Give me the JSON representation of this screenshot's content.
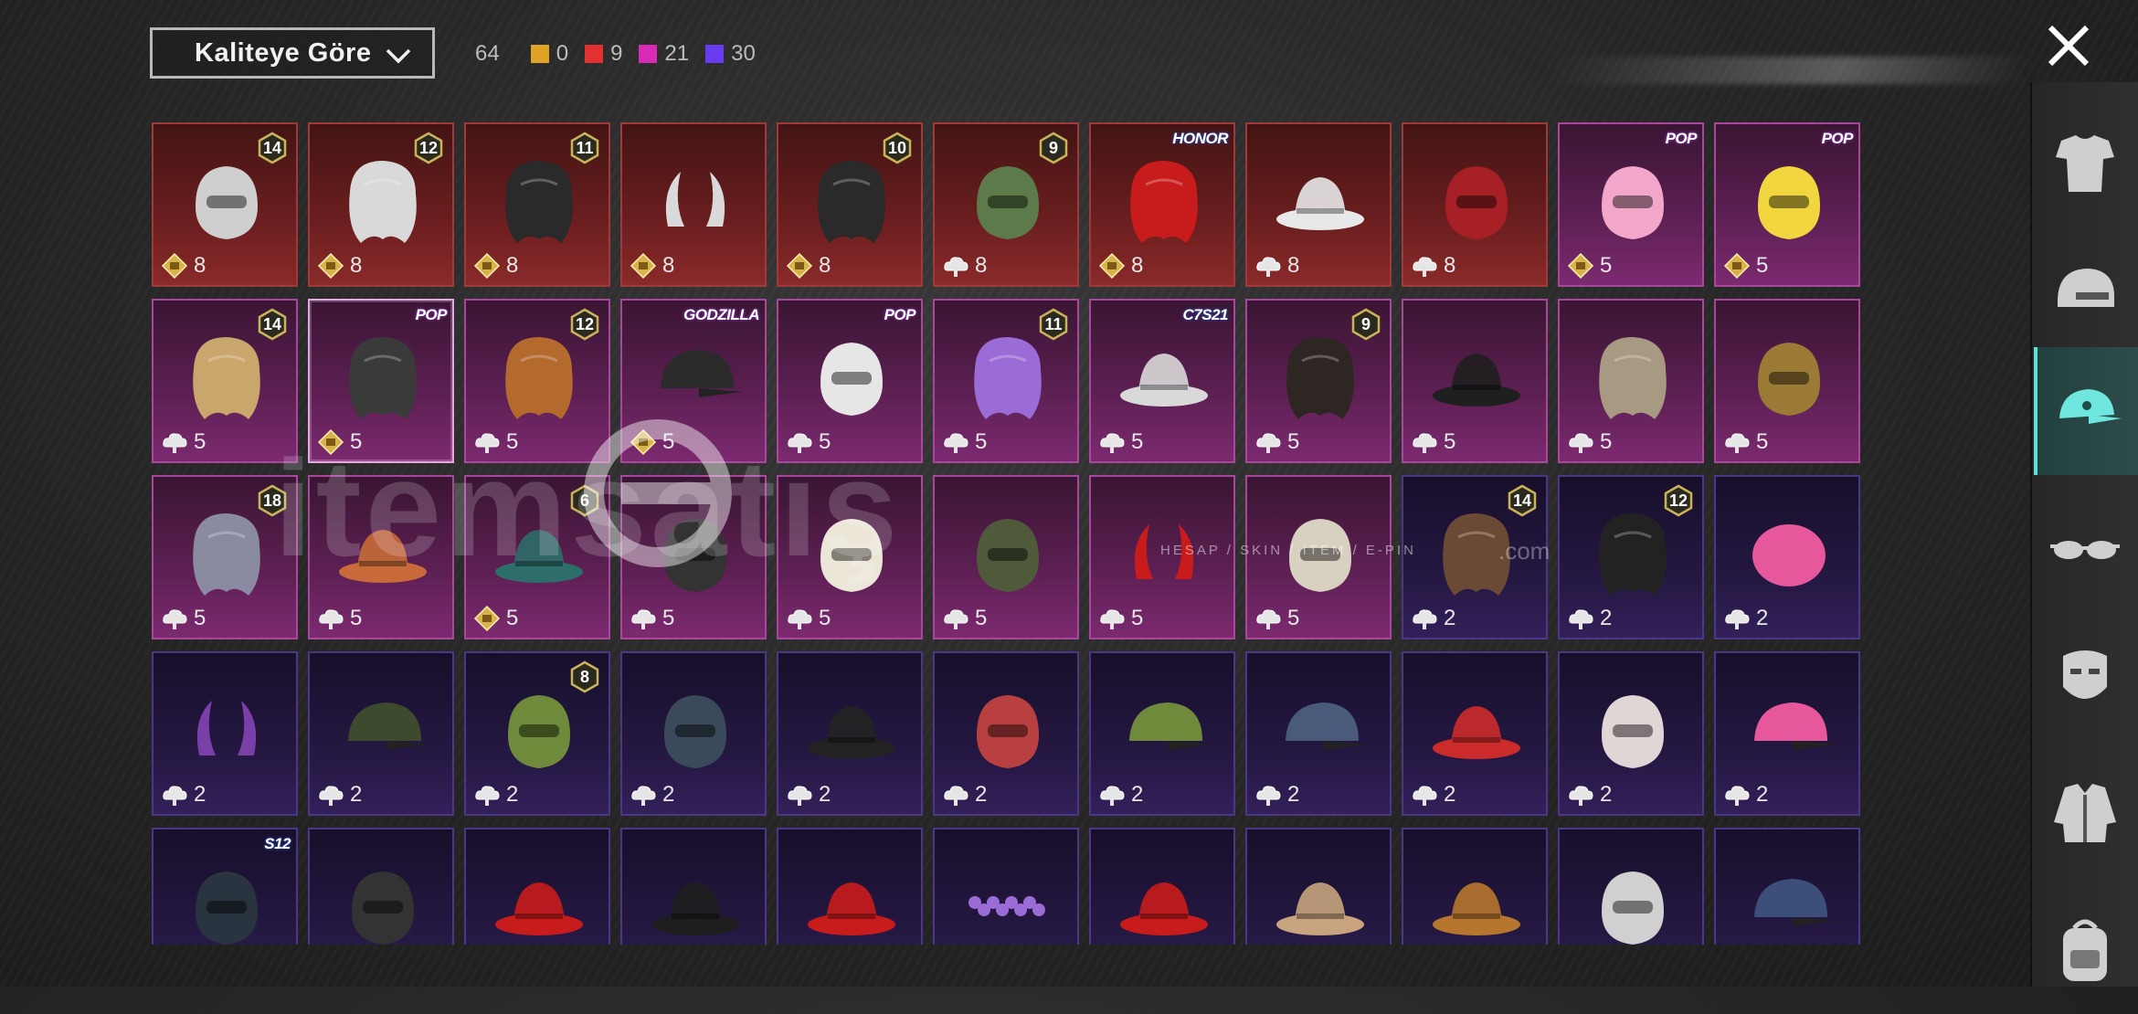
{
  "sort": {
    "label": "Kaliteye Göre",
    "icon": "chevron-down-icon"
  },
  "counts": {
    "total": "64",
    "items": [
      {
        "color": "#e0a324",
        "value": "0"
      },
      {
        "color": "#e33030",
        "value": "9"
      },
      {
        "color": "#d82ab5",
        "value": "21"
      },
      {
        "color": "#6a3cf0",
        "value": "30"
      }
    ]
  },
  "close": {
    "icon": "close-icon"
  },
  "watermark": {
    "brand": "itemsatış",
    "tagline": "HESAP / SKIN / ITEM / E-PIN",
    "tld": ".com"
  },
  "items": [
    {
      "q": "red",
      "art": "cat-mask-helmet",
      "lvl": "14",
      "cur": "gold",
      "cost": "8"
    },
    {
      "q": "red",
      "art": "white-hair",
      "lvl": "12",
      "cur": "gold",
      "cost": "8"
    },
    {
      "q": "red",
      "art": "dark-hair",
      "lvl": "11",
      "cur": "gold",
      "cost": "8"
    },
    {
      "q": "red",
      "art": "white-horned-hair",
      "cur": "gold",
      "cost": "8"
    },
    {
      "q": "red",
      "art": "dark-wavy-hair",
      "lvl": "10",
      "cur": "gold",
      "cost": "8"
    },
    {
      "q": "red",
      "art": "zombie-head",
      "lvl": "9",
      "cur": "silver",
      "cost": "8"
    },
    {
      "q": "red",
      "art": "red-hair",
      "badge": "HONOR",
      "cur": "gold",
      "cost": "8"
    },
    {
      "q": "red",
      "art": "cowboy-hat",
      "cur": "silver",
      "cost": "8"
    },
    {
      "q": "red",
      "art": "oni-mask-helmet",
      "cur": "silver",
      "cost": "8"
    },
    {
      "q": "pink",
      "art": "bow-headband",
      "badge": "POP",
      "cur": "gold",
      "cost": "5"
    },
    {
      "q": "pink",
      "art": "yellow-box-head",
      "badge": "POP",
      "cur": "gold",
      "cost": "5"
    },
    {
      "q": "pink",
      "art": "blonde-hair",
      "lvl": "14",
      "cur": "silver",
      "cost": "5"
    },
    {
      "q": "pink",
      "sel": true,
      "art": "ribbon-hair",
      "badge": "POP",
      "cur": "gold",
      "cost": "5"
    },
    {
      "q": "pink",
      "art": "orange-hair",
      "lvl": "12",
      "cur": "silver",
      "cost": "5"
    },
    {
      "q": "pink",
      "art": "spiked-cap",
      "badge": "GODZILLA",
      "cur": "gold",
      "cost": "5"
    },
    {
      "q": "pink",
      "art": "panda-head",
      "badge": "POP",
      "cur": "silver",
      "cost": "5"
    },
    {
      "q": "pink",
      "art": "flower-hair",
      "lvl": "11",
      "cur": "silver",
      "cost": "5"
    },
    {
      "q": "pink",
      "art": "white-fur-hat",
      "badge": "C7S21",
      "cur": "silver",
      "cost": "5"
    },
    {
      "q": "pink",
      "art": "long-dark-hair",
      "lvl": "9",
      "cur": "silver",
      "cost": "5"
    },
    {
      "q": "pink",
      "art": "pirate-hat",
      "cur": "silver",
      "cost": "5"
    },
    {
      "q": "pink",
      "art": "curly-hair",
      "cur": "silver",
      "cost": "5"
    },
    {
      "q": "pink",
      "art": "golden-horn-helmet",
      "cur": "silver",
      "cost": "5"
    },
    {
      "q": "pink",
      "art": "crown-hair",
      "lvl": "18",
      "cur": "silver",
      "cost": "5"
    },
    {
      "q": "pink",
      "art": "antler-hat",
      "cur": "silver",
      "cost": "5"
    },
    {
      "q": "pink",
      "art": "tree-hat",
      "lvl": "6",
      "cur": "gold",
      "cost": "5"
    },
    {
      "q": "pink",
      "art": "sport-helmet",
      "cur": "silver",
      "cost": "5"
    },
    {
      "q": "pink",
      "art": "sheep-head",
      "cur": "silver",
      "cost": "5"
    },
    {
      "q": "pink",
      "art": "military-helmet",
      "cur": "silver",
      "cost": "5"
    },
    {
      "q": "pink",
      "art": "red-horns",
      "cur": "silver",
      "cost": "5"
    },
    {
      "q": "pink",
      "art": "chicken-head",
      "cur": "silver",
      "cost": "5"
    },
    {
      "q": "purple",
      "art": "feather-hair",
      "lvl": "14",
      "cur": "silver",
      "cost": "2"
    },
    {
      "q": "purple",
      "art": "bunny-ear-hair",
      "lvl": "12",
      "cur": "silver",
      "cost": "2"
    },
    {
      "q": "purple",
      "art": "pink-beanie",
      "cur": "silver",
      "cost": "2"
    },
    {
      "q": "purple",
      "art": "demon-horns",
      "cur": "silver",
      "cost": "2"
    },
    {
      "q": "purple",
      "art": "officer-caps",
      "cur": "silver",
      "cost": "2"
    },
    {
      "q": "purple",
      "art": "green-skull-hood",
      "lvl": "8",
      "cur": "silver",
      "cost": "2"
    },
    {
      "q": "purple",
      "art": "gas-mask-helmet",
      "cur": "silver",
      "cost": "2"
    },
    {
      "q": "purple",
      "art": "witch-hat",
      "cur": "silver",
      "cost": "2"
    },
    {
      "q": "purple",
      "art": "football-helmet",
      "cur": "silver",
      "cost": "2"
    },
    {
      "q": "purple",
      "art": "green-cap",
      "cur": "silver",
      "cost": "2"
    },
    {
      "q": "purple",
      "art": "blue-cap",
      "cur": "silver",
      "cost": "2"
    },
    {
      "q": "purple",
      "art": "mushroom-hat",
      "cur": "silver",
      "cost": "2"
    },
    {
      "q": "purple",
      "art": "clown-mask",
      "cur": "silver",
      "cost": "2"
    },
    {
      "q": "purple",
      "art": "pink-cap",
      "cur": "silver",
      "cost": "2"
    },
    {
      "q": "purple",
      "art": "s12-helmet",
      "badge": "S12"
    },
    {
      "q": "purple",
      "art": "ski-mask"
    },
    {
      "q": "purple",
      "art": "red-beret"
    },
    {
      "q": "purple",
      "art": "black-fedora"
    },
    {
      "q": "purple",
      "art": "red-fedora"
    },
    {
      "q": "purple",
      "art": "flower-crown"
    },
    {
      "q": "purple",
      "art": "red-bucket-hat"
    },
    {
      "q": "purple",
      "art": "cake-hat"
    },
    {
      "q": "purple",
      "art": "burger-hat"
    },
    {
      "q": "purple",
      "art": "headlamp"
    },
    {
      "q": "purple",
      "art": "sailor-cap"
    }
  ],
  "sidebar": [
    {
      "icon": "outfit-icon"
    },
    {
      "icon": "helmet-icon"
    },
    {
      "icon": "cap-icon",
      "active": true
    },
    {
      "icon": "glasses-icon"
    },
    {
      "icon": "mask-icon"
    },
    {
      "icon": "jacket-icon"
    },
    {
      "icon": "backpack-icon"
    }
  ]
}
